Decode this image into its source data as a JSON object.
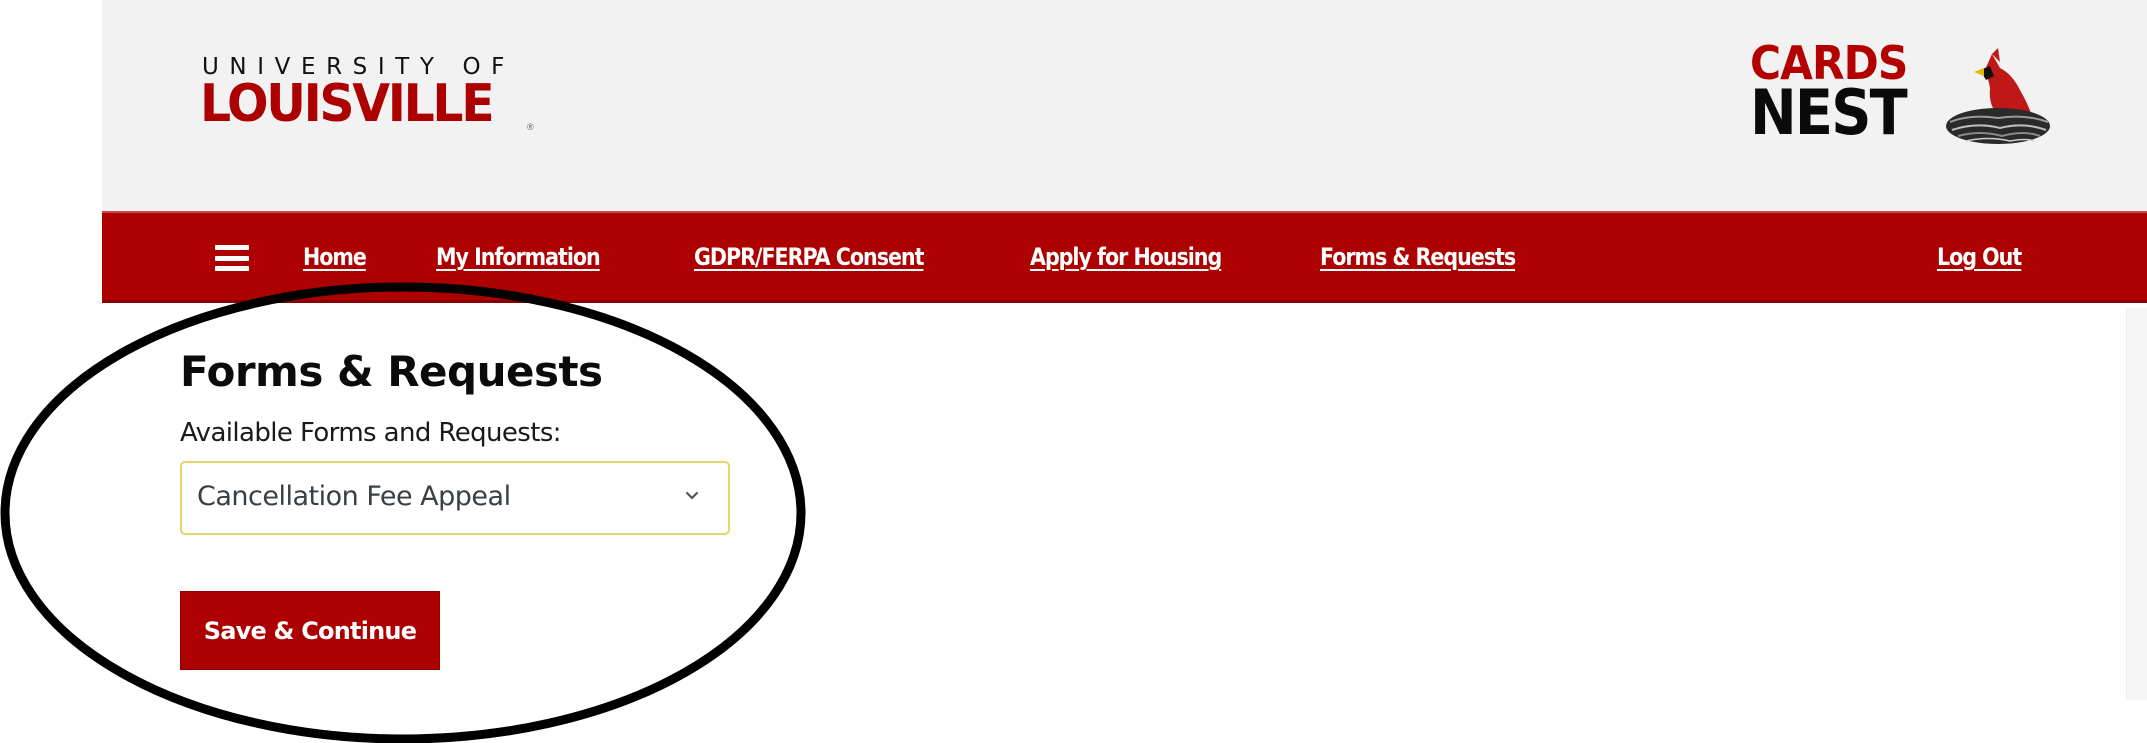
{
  "header": {
    "university_logo": {
      "line1": "UNIVERSITY OF",
      "line2": "LOUISVILLE",
      "registered_mark": "®"
    },
    "portal_logo": {
      "line1": "CARDS",
      "line2": "NEST",
      "icon": "cardinal-in-nest-icon"
    }
  },
  "nav": {
    "menu_icon": "hamburger-menu-icon",
    "items": [
      {
        "label": "Home"
      },
      {
        "label": "My Information"
      },
      {
        "label": "GDPR/FERPA Consent"
      },
      {
        "label": "Apply for Housing"
      },
      {
        "label": "Forms & Requests"
      }
    ],
    "logout_label": "Log Out"
  },
  "main": {
    "title": "Forms & Requests",
    "field_label": "Available Forms and Requests:",
    "select": {
      "selected_value": "Cancellation Fee Appeal",
      "icon": "chevron-down-icon"
    },
    "save_button_label": "Save & Continue"
  },
  "colors": {
    "brand_red": "#ad0000",
    "header_bg": "#f2f2f2",
    "select_border": "#e6d56b",
    "annotation": "#000000"
  }
}
